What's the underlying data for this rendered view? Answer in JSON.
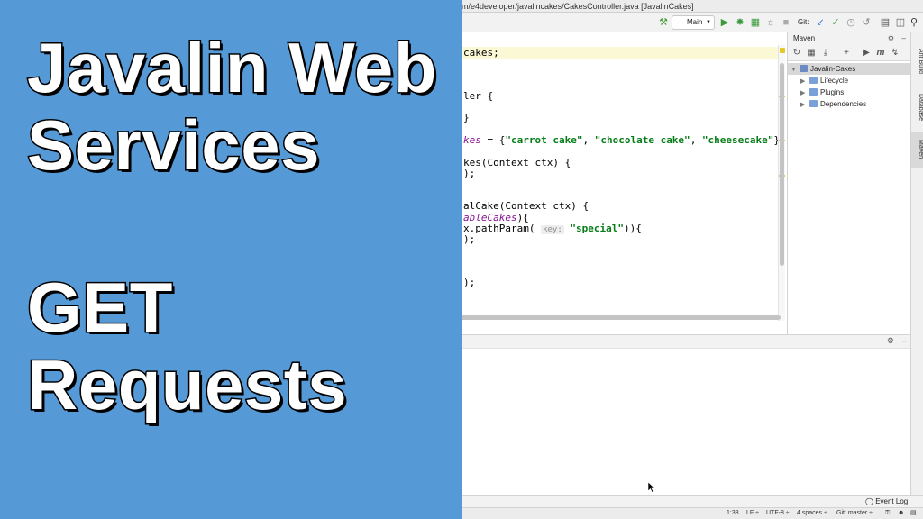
{
  "window": {
    "title": "m/e4developer/javalincakes/CakesController.java [JavalinCakes]"
  },
  "toolbar": {
    "run_config": "Main",
    "git_label": "Git:"
  },
  "editor": {
    "lines": [
      {
        "pre": "cakes;",
        "str": "",
        "field": "",
        "hint": "",
        "post": ""
      },
      {
        "pre": "ler {",
        "str": "",
        "field": "",
        "hint": "",
        "post": ""
      },
      {
        "pre": "}",
        "str": "",
        "field": "",
        "hint": "",
        "post": ""
      },
      {
        "pre": "",
        "field": "kes",
        "mid": " = {",
        "s1": "\"carrot cake\"",
        "c1": ", ",
        "s2": "\"chocolate cake\"",
        "c2": ", ",
        "s3": "\"cheesecake\"",
        "post": "};"
      },
      {
        "pre": "kes(Context ctx) {",
        "str": "",
        "field": "",
        "hint": "",
        "post": ""
      },
      {
        "pre": ");",
        "str": "",
        "field": "",
        "hint": "",
        "post": ""
      },
      {
        "pre": "alCake(Context ctx) {",
        "str": "",
        "field": "",
        "hint": "",
        "post": ""
      },
      {
        "pre": "",
        "field": "ableCakes",
        "post": "){"
      },
      {
        "pre": "x.pathParam( ",
        "hint": "key:",
        "str": "\"special\"",
        "post": ")){"
      },
      {
        "pre": ");",
        "str": "",
        "field": "",
        "hint": "",
        "post": ""
      },
      {
        "pre": ");",
        "str": "",
        "field": "",
        "hint": "",
        "post": ""
      }
    ]
  },
  "maven": {
    "title": "Maven",
    "tree": [
      {
        "label": "Javalin-Cakes",
        "color": "#6a8bc4"
      },
      {
        "label": "Lifecycle",
        "color": "#7aa0d8"
      },
      {
        "label": "Plugins",
        "color": "#7aa0d8"
      },
      {
        "label": "Dependencies",
        "color": "#7aa0d8"
      }
    ]
  },
  "side_tabs": {
    "ant": "Ant Build",
    "database": "Database",
    "maven": "Maven"
  },
  "event_log": "Event Log",
  "status": {
    "position": "1:38",
    "line_sep": "LF ÷",
    "encoding": "UTF-8 ÷",
    "indent": "4 spaces ÷",
    "git": "Git: master ÷"
  },
  "card": {
    "line1": "Javalin Web",
    "line2": "Services",
    "line3": "GET",
    "line4": "Requests",
    "color": "#5599d6"
  }
}
